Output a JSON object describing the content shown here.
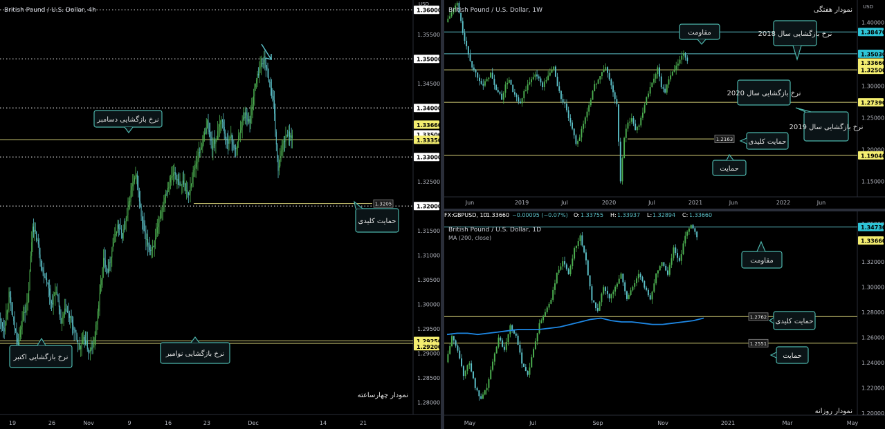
{
  "colors": {
    "up": "#4caf50",
    "up_fill": "#2e7d32",
    "down": "#5bc0c8",
    "level_yellow": "#d8d37a",
    "level_cyan": "#5bc0c8",
    "ma_blue": "#1e88e5",
    "box_bg": "#0b1417",
    "box_border": "#4db6ac",
    "label_yellow_bg": "#f4ee70",
    "label_cyan_bg": "#2ec4d6",
    "label_white_bg": "#ffffff",
    "axis_text": "#b2b5be",
    "panel_text": "#d1d4dc"
  },
  "chart_data": [
    {
      "id": "gbpusd-4h",
      "type": "candlestick",
      "title": "British Pound / U.S. Dollar, 4h",
      "caption": "نمودار چهارساعته",
      "currency": "USD",
      "ylim": [
        1.2775,
        1.362
      ],
      "yticks": [
        "1.28000",
        "1.28500",
        "1.29000",
        "1.29500",
        "1.30000",
        "1.30500",
        "1.31000",
        "1.31500",
        "1.32000",
        "1.32500",
        "1.33000",
        "1.33500",
        "1.34000",
        "1.34500",
        "1.35000",
        "1.35500",
        "1.36000"
      ],
      "xticks": [
        "19",
        "26",
        "Nov",
        "9",
        "16",
        "23",
        "Dec",
        "14",
        "21"
      ],
      "price_labels": [
        {
          "text": "1.36000",
          "style": "white",
          "value": 1.36
        },
        {
          "text": "1.35000",
          "style": "white",
          "value": 1.35
        },
        {
          "text": "1.34000",
          "style": "white",
          "value": 1.34
        },
        {
          "text": "1.33660",
          "style": "yellow",
          "value": 1.3366
        },
        {
          "text": "1.33500",
          "style": "white",
          "value": 1.3346
        },
        {
          "text": "1.33350",
          "style": "yellow",
          "value": 1.3335
        },
        {
          "text": "1.33000",
          "style": "white",
          "value": 1.33
        },
        {
          "text": "1.32000",
          "style": "white",
          "value": 1.32
        },
        {
          "text": "1.29250",
          "style": "yellow",
          "value": 1.2925
        },
        {
          "text": "1.29200",
          "style": "yellow",
          "value": 1.2914
        }
      ],
      "levels": [
        {
          "value": 1.36,
          "style": "dotted"
        },
        {
          "value": 1.35,
          "style": "dotted"
        },
        {
          "value": 1.34,
          "style": "dotted"
        },
        {
          "value": 1.33,
          "style": "dotted"
        },
        {
          "value": 1.32,
          "style": "dotted"
        },
        {
          "value": 1.3335,
          "style": "yellow"
        },
        {
          "value": 1.2925,
          "style": "yellow"
        },
        {
          "value": 1.292,
          "style": "yellow"
        }
      ],
      "key_level": {
        "value": 1.3205,
        "label": "1.3205"
      },
      "annotations": [
        {
          "text": "نرخ بازگشایی دسامبر"
        },
        {
          "text": "حمایت کلیدی"
        },
        {
          "text": "نرخ بازگشایی اکتبر"
        },
        {
          "text": "نرخ بازگشایی نوامبر"
        }
      ],
      "path": [
        1.297,
        1.295,
        1.302,
        1.296,
        1.292,
        1.298,
        1.3,
        1.316,
        1.313,
        1.307,
        1.305,
        1.3,
        1.303,
        1.296,
        1.299,
        1.297,
        1.294,
        1.291,
        1.293,
        1.29,
        1.292,
        1.3,
        1.309,
        1.307,
        1.312,
        1.316,
        1.314,
        1.318,
        1.324,
        1.326,
        1.318,
        1.313,
        1.311,
        1.313,
        1.318,
        1.322,
        1.325,
        1.327,
        1.324,
        1.325,
        1.322,
        1.327,
        1.33,
        1.333,
        1.337,
        1.332,
        1.334,
        1.338,
        1.333,
        1.334,
        1.331,
        1.336,
        1.339,
        1.337,
        1.344,
        1.348,
        1.35,
        1.346,
        1.341,
        1.327,
        1.333,
        1.335,
        1.334
      ]
    },
    {
      "id": "gbpusd-1w",
      "type": "candlestick",
      "title": "British Pound / U.S. Dollar, 1W",
      "caption": "نمودار هفتگی",
      "currency": "USD",
      "ylim": [
        1.125,
        1.435
      ],
      "yticks": [
        "1.15000",
        "1.20000",
        "1.25000",
        "1.30000",
        "1.35000",
        "1.40000"
      ],
      "xticks": [
        "Jun",
        "2019",
        "Jul",
        "2020",
        "Jul",
        "2021",
        "Jun",
        "2022",
        "Jun"
      ],
      "price_labels": [
        {
          "text": "1.38470",
          "style": "cyan",
          "value": 1.3847
        },
        {
          "text": "1.35030",
          "style": "cyan",
          "value": 1.3503
        },
        {
          "text": "1.33660",
          "style": "yellow",
          "value": 1.3366
        },
        {
          "text": "1.32500",
          "style": "yellow",
          "value": 1.325
        },
        {
          "text": "1.27390",
          "style": "yellow",
          "value": 1.2739
        },
        {
          "text": "1.19040",
          "style": "yellow",
          "value": 1.1904
        }
      ],
      "levels": [
        {
          "value": 1.3847,
          "style": "cyan"
        },
        {
          "value": 1.3503,
          "style": "cyan"
        },
        {
          "value": 1.325,
          "style": "yellow"
        },
        {
          "value": 1.2739,
          "style": "yellow"
        },
        {
          "value": 1.1904,
          "style": "yellow"
        }
      ],
      "key_level": {
        "value": 1.2163,
        "label": "1.2163"
      },
      "annotations": [
        {
          "text": "مقاومت"
        },
        {
          "text": "نرخ بازگشایی سال 2018"
        },
        {
          "text": "نرخ بازگشایی سال 2020"
        },
        {
          "text": "نرخ بازگشایی سال 2019"
        },
        {
          "text": "حمایت کلیدی"
        },
        {
          "text": "حمایت"
        }
      ],
      "path": [
        1.4,
        1.41,
        1.42,
        1.43,
        1.4,
        1.37,
        1.35,
        1.33,
        1.32,
        1.31,
        1.3,
        1.31,
        1.32,
        1.3,
        1.29,
        1.28,
        1.3,
        1.31,
        1.29,
        1.28,
        1.27,
        1.29,
        1.3,
        1.31,
        1.32,
        1.31,
        1.3,
        1.31,
        1.32,
        1.33,
        1.3,
        1.28,
        1.27,
        1.25,
        1.23,
        1.21,
        1.22,
        1.24,
        1.26,
        1.28,
        1.3,
        1.31,
        1.32,
        1.33,
        1.31,
        1.29,
        1.27,
        1.15,
        1.22,
        1.24,
        1.25,
        1.23,
        1.24,
        1.26,
        1.28,
        1.3,
        1.31,
        1.33,
        1.3,
        1.29,
        1.31,
        1.32,
        1.33,
        1.34,
        1.35,
        1.34
      ]
    },
    {
      "id": "gbpusd-1d",
      "type": "candlestick",
      "title": "British Pound / U.S. Dollar, 1D",
      "caption": "نمودار روزانه",
      "ohlc_header": {
        "symbol": "FX:GBPUSD, 1D",
        "last": "1.33660",
        "change": "−0.00095 (−0.07%)",
        "o_label": "O:",
        "o": "1.33755",
        "h_label": "H:",
        "h": "1.33937",
        "l_label": "L:",
        "l": "1.32894",
        "c_label": "C:",
        "c": "1.33660"
      },
      "indicator": "MA (200, close)",
      "ylim": [
        1.198,
        1.352
      ],
      "yticks": [
        "1.20000",
        "1.22000",
        "1.24000",
        "1.26000",
        "1.28000",
        "1.30000",
        "1.32000",
        "1.35000"
      ],
      "xticks": [
        "May",
        "Jul",
        "Sep",
        "Nov",
        "2021",
        "Mar",
        "May"
      ],
      "price_labels": [
        {
          "text": "1.34730",
          "style": "cyan",
          "value": 1.3473
        },
        {
          "text": "1.33660",
          "style": "yellow",
          "value": 1.3366
        }
      ],
      "levels": [
        {
          "value": 1.3473,
          "style": "cyan"
        },
        {
          "value": 1.2762,
          "style": "yellow"
        },
        {
          "value": 1.2551,
          "style": "yellow"
        }
      ],
      "key_level": {
        "value": 1.2762,
        "label": "1.2762"
      },
      "support_level": {
        "value": 1.2551,
        "label": "1.2551"
      },
      "annotations": [
        {
          "text": "مقاومت"
        },
        {
          "text": "حمایت کلیدی"
        },
        {
          "text": "حمایت"
        }
      ],
      "ma": [
        1.262,
        1.263,
        1.263,
        1.262,
        1.263,
        1.264,
        1.265,
        1.266,
        1.266,
        1.266,
        1.267,
        1.268,
        1.27,
        1.272,
        1.274,
        1.275,
        1.273,
        1.272,
        1.272,
        1.271,
        1.27,
        1.27,
        1.271,
        1.272,
        1.273,
        1.275
      ],
      "path": [
        1.24,
        1.26,
        1.25,
        1.23,
        1.24,
        1.22,
        1.21,
        1.22,
        1.24,
        1.26,
        1.25,
        1.27,
        1.26,
        1.24,
        1.23,
        1.25,
        1.27,
        1.28,
        1.29,
        1.31,
        1.32,
        1.31,
        1.33,
        1.34,
        1.32,
        1.29,
        1.28,
        1.3,
        1.29,
        1.3,
        1.31,
        1.29,
        1.3,
        1.31,
        1.3,
        1.29,
        1.31,
        1.32,
        1.31,
        1.33,
        1.32,
        1.34,
        1.35,
        1.34
      ]
    }
  ]
}
